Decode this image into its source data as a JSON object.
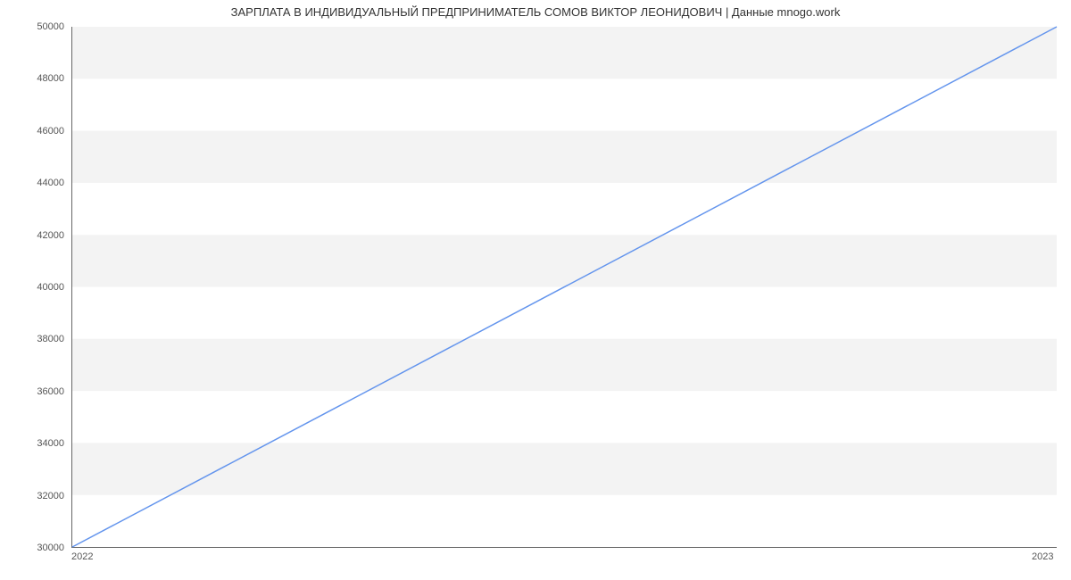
{
  "chart_data": {
    "type": "line",
    "title": "ЗАРПЛАТА В ИНДИВИДУАЛЬНЫЙ ПРЕДПРИНИМАТЕЛЬ СОМОВ ВИКТОР ЛЕОНИДОВИЧ | Данные mnogo.work",
    "x": [
      2022,
      2023
    ],
    "values": [
      30000,
      50000
    ],
    "xlabel": "",
    "ylabel": "",
    "x_ticks": [
      2022,
      2023
    ],
    "y_ticks": [
      30000,
      32000,
      34000,
      36000,
      38000,
      40000,
      42000,
      44000,
      46000,
      48000,
      50000
    ],
    "xlim": [
      2022,
      2023
    ],
    "ylim": [
      30000,
      50000
    ],
    "line_color": "#6495ed",
    "grid": "horizontal-bands"
  }
}
